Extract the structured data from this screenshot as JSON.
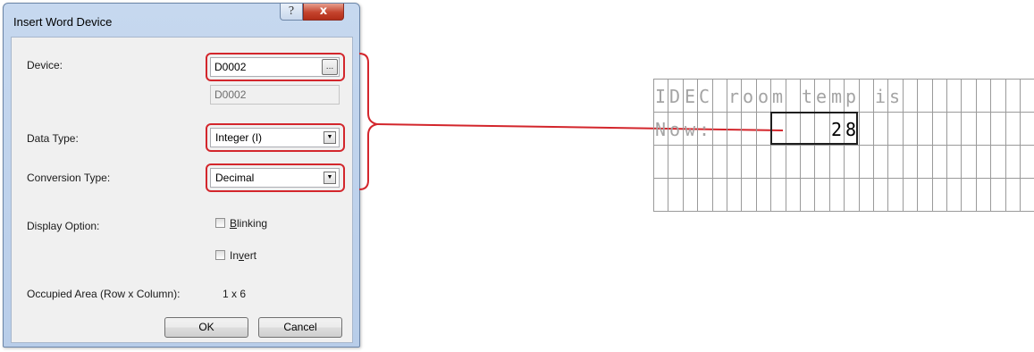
{
  "dialog": {
    "title": "Insert Word Device",
    "help_glyph": "?",
    "close_glyph": "x",
    "device": {
      "label": "Device:",
      "value": "D0002",
      "readonly_value": "D0002",
      "browse_label": "..."
    },
    "data_type": {
      "label": "Data Type:",
      "selected": "Integer (I)"
    },
    "conversion_type": {
      "label": "Conversion Type:",
      "selected": "Decimal"
    },
    "display_option": {
      "label": "Display Option:",
      "blinking_prefix": "B",
      "blinking_rest": "linking",
      "invert_prefix": "In",
      "invert_underlined": "v",
      "invert_rest": "ert"
    },
    "occupied_area": {
      "label": "Occupied Area (Row x Column):",
      "value": "1 x 6"
    },
    "ok_label": "OK",
    "cancel_label": "Cancel"
  },
  "lcd": {
    "rows": [
      [
        "I",
        "D",
        "E",
        "C",
        " ",
        "r",
        "o",
        "o",
        "m",
        " ",
        "t",
        "e",
        "m",
        "p",
        " ",
        "i",
        "s",
        " ",
        " ",
        " ",
        " ",
        " ",
        " ",
        " ",
        " ",
        " "
      ],
      [
        "N",
        "o",
        "w",
        ":",
        " ",
        " ",
        " ",
        " ",
        " ",
        " ",
        " ",
        " ",
        "2",
        "8",
        " ",
        " ",
        " ",
        " ",
        " ",
        " ",
        " ",
        " ",
        " ",
        " ",
        " ",
        " "
      ],
      [
        " ",
        " ",
        " ",
        " ",
        " ",
        " ",
        " ",
        " ",
        " ",
        " ",
        " ",
        " ",
        " ",
        " ",
        " ",
        " ",
        " ",
        " ",
        " ",
        " ",
        " ",
        " ",
        " ",
        " ",
        " ",
        " ",
        " "
      ],
      [
        " ",
        " ",
        " ",
        " ",
        " ",
        " ",
        " ",
        " ",
        " ",
        " ",
        " ",
        " ",
        " ",
        " ",
        " ",
        " ",
        " ",
        " ",
        " ",
        " ",
        " ",
        " ",
        " ",
        " ",
        " ",
        " ",
        " "
      ]
    ],
    "highlight_color": "#d3262c"
  }
}
